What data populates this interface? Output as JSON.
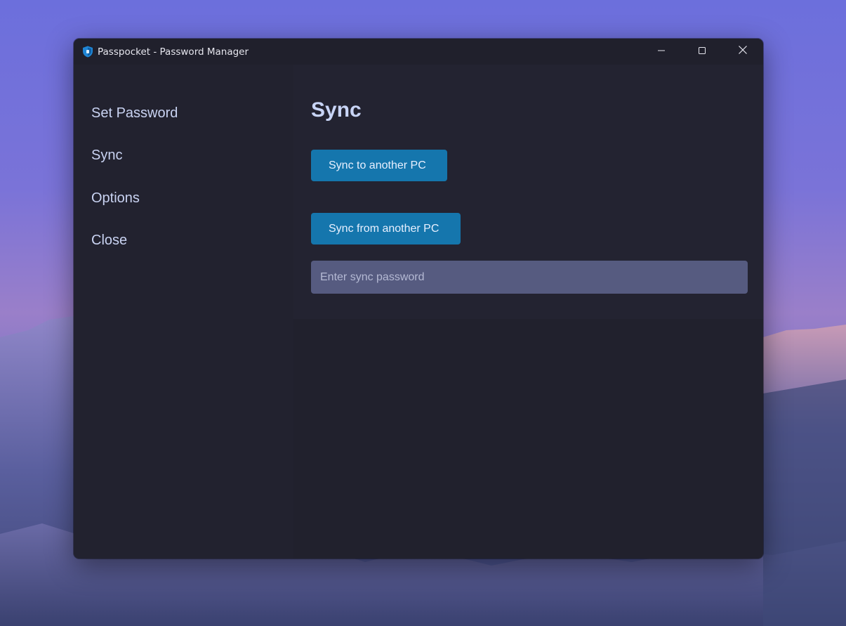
{
  "window": {
    "title": "Passpocket - Password Manager",
    "app_icon": "shield-icon",
    "controls": {
      "minimize_icon": "minimize-icon",
      "maximize_icon": "maximize-icon",
      "close_icon": "close-icon"
    }
  },
  "sidebar": {
    "items": [
      {
        "label": "Set Password"
      },
      {
        "label": "Sync"
      },
      {
        "label": "Options"
      },
      {
        "label": "Close"
      }
    ]
  },
  "main": {
    "title": "Sync",
    "sync_to_label": "Sync to another PC",
    "sync_from_label": "Sync from another PC",
    "password_input": {
      "value": "",
      "placeholder": "Enter sync password"
    }
  },
  "colors": {
    "accent": "#1576ad",
    "window_bg": "#22222f",
    "input_bg": "#565b80",
    "text": "#c9d3f2"
  }
}
